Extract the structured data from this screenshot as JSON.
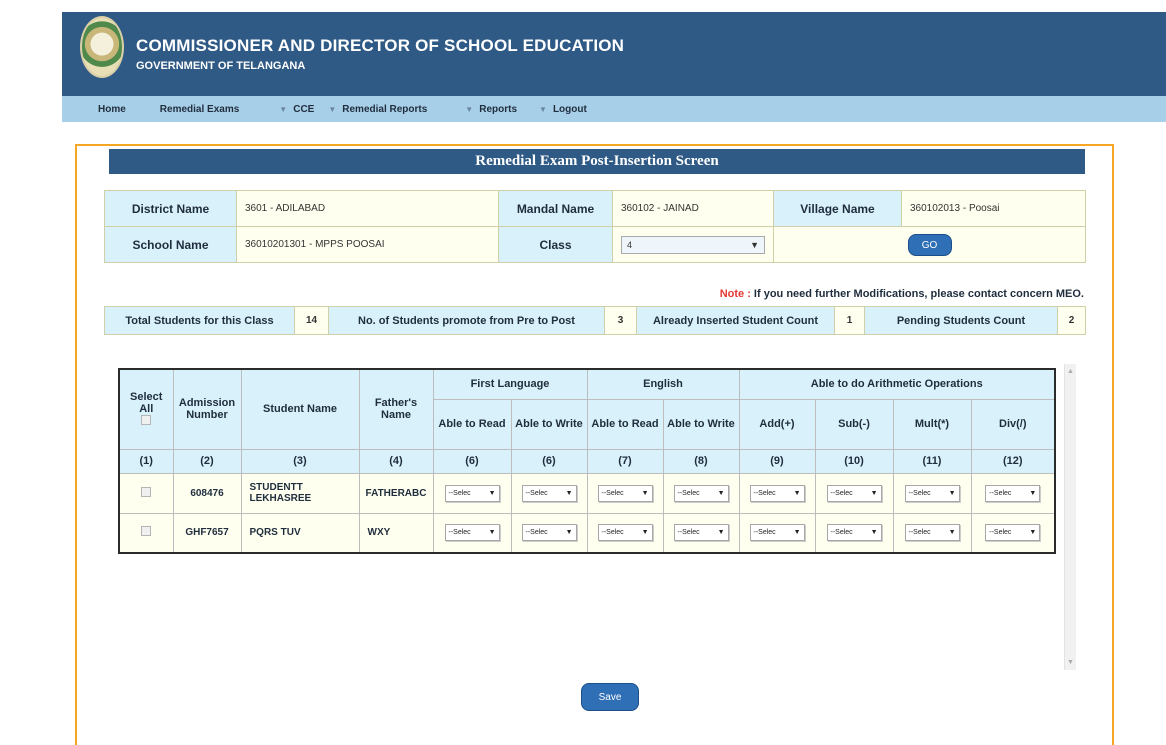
{
  "header": {
    "title": "COMMISSIONER AND DIRECTOR OF SCHOOL EDUCATION",
    "subtitle": "GOVERNMENT OF TELANGANA",
    "bg_color": "#2f5a85"
  },
  "nav": {
    "items": [
      "Home",
      "Remedial Exams",
      "CCE",
      "Remedial Reports",
      "Reports",
      "Logout"
    ]
  },
  "page": {
    "title": "Remedial Exam Post-Insertion Screen"
  },
  "info": {
    "district_label": "District Name",
    "district_value": "3601 - ADILABAD",
    "mandal_label": "Mandal Name",
    "mandal_value": "360102 - JAINAD",
    "village_label": "Village Name",
    "village_value": "360102013 - Poosai",
    "school_label": "School Name",
    "school_value": "36010201301 - MPPS POOSAI",
    "class_label": "Class",
    "class_value": "4",
    "go_label": "GO"
  },
  "note": {
    "prefix": "Note :",
    "text": " If you need further Modifications, please contact concern MEO."
  },
  "counts": {
    "total_label": "Total Students for this Class",
    "total_value": "14",
    "promoted_label": "No. of Students promote from Pre to Post",
    "promoted_value": "3",
    "inserted_label": "Already Inserted Student Count",
    "inserted_value": "1",
    "pending_label": "Pending Students Count",
    "pending_value": "2"
  },
  "grid": {
    "headers": {
      "select_all": "Select All",
      "admission": "Admission Number",
      "student": "Student Name",
      "father": "Father's Name",
      "first_language": "First Language",
      "english": "English",
      "arith": "Able to do Arithmetic Operations",
      "read": "Able to Read",
      "write": "Able to Write",
      "add": "Add(+)",
      "sub": "Sub(-)",
      "mult": "Mult(*)",
      "div": "Div(/)"
    },
    "col_numbers": [
      "(1)",
      "(2)",
      "(3)",
      "(4)",
      "(6)",
      "(6)",
      "(7)",
      "(8)",
      "(9)",
      "(10)",
      "(11)",
      "(12)"
    ],
    "select_placeholder": "--Selec",
    "rows": [
      {
        "admission": "608476",
        "student": "STUDENTT LEKHASREE",
        "father": "FATHERABC"
      },
      {
        "admission": "GHF7657",
        "student": "PQRS TUV",
        "father": "WXY"
      }
    ]
  },
  "save_label": "Save"
}
